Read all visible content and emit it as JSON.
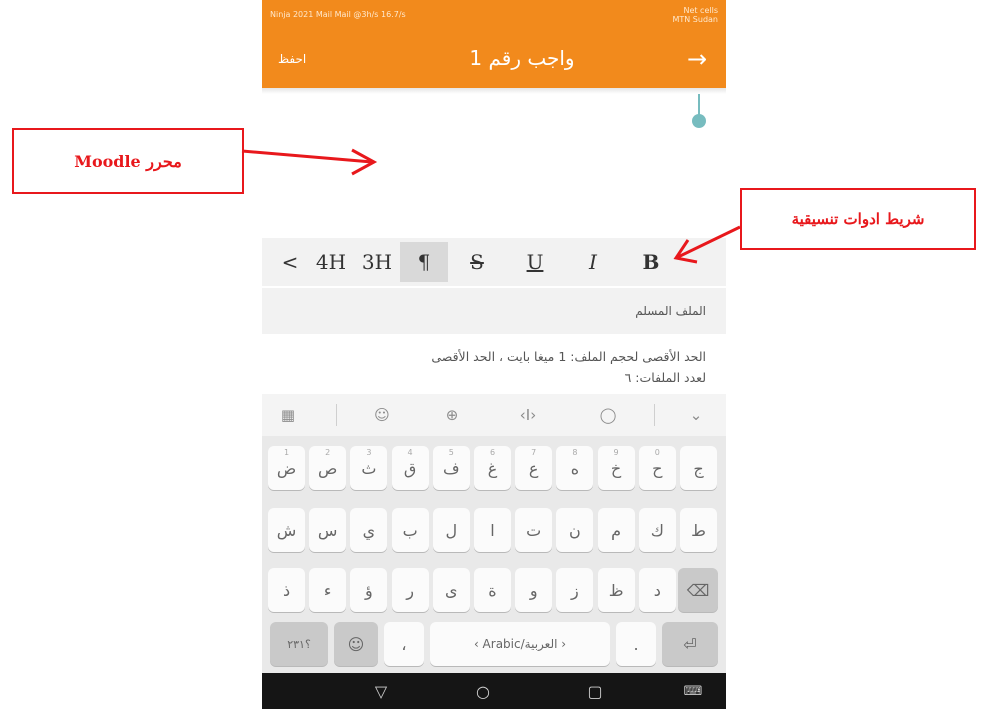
{
  "status_bar": {
    "left_text": "Ninja 2021 Mail Mail @3h/s 16.7/s",
    "right_text": "Net cells\nMTN Sudan"
  },
  "app_bar": {
    "title": "واجب رقم 1",
    "save_label": "احفظ",
    "back_icon": "arrow-right-icon"
  },
  "editor": {
    "content": "",
    "cursor_color": "#77bcbf"
  },
  "toolbar": {
    "buttons": [
      {
        "label": "<",
        "name": "toolbar-more-button"
      },
      {
        "label": "4H",
        "name": "toolbar-h4-button"
      },
      {
        "label": "3H",
        "name": "toolbar-h3-button"
      },
      {
        "label": "¶",
        "name": "toolbar-paragraph-button"
      },
      {
        "label": "S",
        "name": "toolbar-strikethrough-button"
      },
      {
        "label": "U",
        "name": "toolbar-underline-button"
      },
      {
        "label": "I",
        "name": "toolbar-italic-button"
      },
      {
        "label": "B",
        "name": "toolbar-bold-button"
      }
    ]
  },
  "file_section": {
    "label": "الملف المسلم",
    "info_line1": "الحد الأقصى لحجم الملف: 1 ميغا بايت ، الحد الأقصى",
    "info_line2": "لعدد الملفات: ٦"
  },
  "keyboard": {
    "suggest_icons": [
      "apps-icon",
      "emoji-icon",
      "globe-icon",
      "cursor-move-icon",
      "search-icon",
      "chevron-down-icon"
    ],
    "row1": [
      {
        "ch": "ض",
        "num": "1"
      },
      {
        "ch": "ص",
        "num": "2"
      },
      {
        "ch": "ث",
        "num": "3"
      },
      {
        "ch": "ق",
        "num": "4"
      },
      {
        "ch": "ف",
        "num": "5"
      },
      {
        "ch": "غ",
        "num": "6"
      },
      {
        "ch": "ع",
        "num": "7"
      },
      {
        "ch": "ه",
        "num": "8"
      },
      {
        "ch": "خ",
        "num": "9"
      },
      {
        "ch": "ح",
        "num": "0"
      },
      {
        "ch": "ج",
        "num": ""
      }
    ],
    "row2": [
      "ش",
      "س",
      "ي",
      "ب",
      "ل",
      "ا",
      "ت",
      "ن",
      "م",
      "ك",
      "ط"
    ],
    "row3": [
      "ذ",
      "ء",
      "ؤ",
      "ر",
      "ى",
      "ة",
      "و",
      "ز",
      "ظ",
      "د"
    ],
    "symbols_key": "؟٢٣١",
    "comma_key": "،",
    "space_label": "‹ Arabic/العربية ›",
    "period_key": ".",
    "backspace_icon": "backspace-icon",
    "enter_icon": "enter-icon",
    "emoji_icon": "emoji-icon"
  },
  "nav_bar": {
    "icons": [
      "back-triangle-icon",
      "home-circle-icon",
      "recents-square-icon",
      "keyboard-icon"
    ]
  },
  "annotations": {
    "editor_callout": "محرر Moodle",
    "toolbar_callout": "شريط ادوات تنسيقية",
    "color": "#e8181c"
  }
}
